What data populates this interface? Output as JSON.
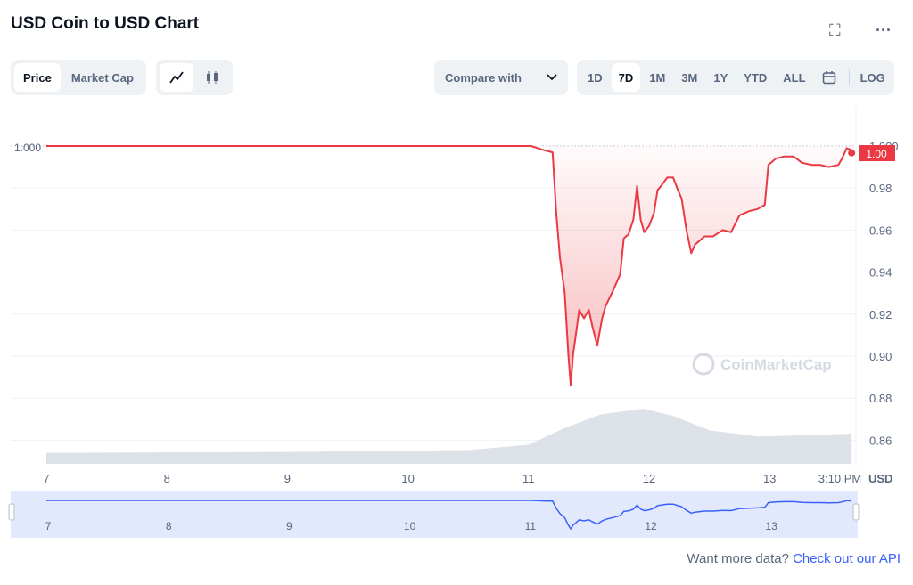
{
  "header": {
    "title": "USD Coin to USD Chart",
    "fullscreen_icon": "expand-icon",
    "more_icon": "more-horizontal-icon"
  },
  "toolbar": {
    "metric_tabs": [
      {
        "label": "Price",
        "active": true
      },
      {
        "label": "Market Cap",
        "active": false
      }
    ],
    "chart_types": [
      {
        "icon": "line-chart-icon",
        "active": true
      },
      {
        "icon": "candlestick-icon",
        "active": false
      }
    ],
    "compare_label": "Compare with",
    "ranges": [
      {
        "label": "1D"
      },
      {
        "label": "7D",
        "active": true
      },
      {
        "label": "1M"
      },
      {
        "label": "3M"
      },
      {
        "label": "1Y"
      },
      {
        "label": "YTD"
      },
      {
        "label": "ALL"
      }
    ],
    "log_label": "LOG"
  },
  "chart_data": {
    "type": "line",
    "ylim": [
      0.85,
      1.0
    ],
    "yticks": [
      "1.000",
      "0.98",
      "0.96",
      "0.94",
      "0.92",
      "0.90",
      "0.88",
      "0.86"
    ],
    "xticks": [
      "7",
      "8",
      "9",
      "10",
      "11",
      "12",
      "13",
      "3:10 PM"
    ],
    "xtick_values": [
      7,
      8,
      9,
      10,
      11,
      12,
      13
    ],
    "unit": "USD",
    "reference_label": "1.000",
    "current_price": "1.00",
    "watermark": "CoinMarketCap",
    "colors": {
      "line": "#ea3943",
      "line_flat": "#16c784",
      "navigator": "#3861fb",
      "volume": "#dde1e8"
    },
    "points": [
      [
        7.0,
        1.0
      ],
      [
        11.02,
        1.0
      ],
      [
        11.13,
        0.998
      ],
      [
        11.2,
        0.997
      ],
      [
        11.23,
        0.968
      ],
      [
        11.26,
        0.947
      ],
      [
        11.3,
        0.93
      ],
      [
        11.33,
        0.901
      ],
      [
        11.35,
        0.886
      ],
      [
        11.37,
        0.901
      ],
      [
        11.39,
        0.909
      ],
      [
        11.42,
        0.922
      ],
      [
        11.46,
        0.918
      ],
      [
        11.5,
        0.922
      ],
      [
        11.53,
        0.914
      ],
      [
        11.57,
        0.905
      ],
      [
        11.61,
        0.918
      ],
      [
        11.64,
        0.924
      ],
      [
        11.7,
        0.931
      ],
      [
        11.76,
        0.939
      ],
      [
        11.79,
        0.956
      ],
      [
        11.83,
        0.958
      ],
      [
        11.87,
        0.965
      ],
      [
        11.9,
        0.981
      ],
      [
        11.93,
        0.965
      ],
      [
        11.96,
        0.959
      ],
      [
        12.0,
        0.962
      ],
      [
        12.04,
        0.968
      ],
      [
        12.07,
        0.979
      ],
      [
        12.1,
        0.981
      ],
      [
        12.15,
        0.985
      ],
      [
        12.2,
        0.985
      ],
      [
        12.24,
        0.979
      ],
      [
        12.27,
        0.975
      ],
      [
        12.31,
        0.96
      ],
      [
        12.35,
        0.949
      ],
      [
        12.38,
        0.953
      ],
      [
        12.46,
        0.957
      ],
      [
        12.53,
        0.957
      ],
      [
        12.61,
        0.96
      ],
      [
        12.68,
        0.959
      ],
      [
        12.75,
        0.967
      ],
      [
        12.83,
        0.969
      ],
      [
        12.9,
        0.97
      ],
      [
        12.96,
        0.972
      ],
      [
        12.99,
        0.991
      ],
      [
        13.05,
        0.994
      ],
      [
        13.12,
        0.995
      ],
      [
        13.2,
        0.995
      ],
      [
        13.27,
        0.992
      ],
      [
        13.35,
        0.991
      ],
      [
        13.42,
        0.991
      ],
      [
        13.49,
        0.99
      ],
      [
        13.57,
        0.991
      ],
      [
        13.6,
        0.994
      ],
      [
        13.64,
        0.999
      ],
      [
        13.68,
        0.998
      ]
    ],
    "volume_relative": [
      [
        7.0,
        0.08
      ],
      [
        9.0,
        0.1
      ],
      [
        10.5,
        0.14
      ],
      [
        11.0,
        0.25
      ],
      [
        11.3,
        0.6
      ],
      [
        11.6,
        0.88
      ],
      [
        11.95,
        1.0
      ],
      [
        12.2,
        0.85
      ],
      [
        12.5,
        0.55
      ],
      [
        12.9,
        0.42
      ],
      [
        13.3,
        0.45
      ],
      [
        13.68,
        0.48
      ]
    ]
  },
  "footer": {
    "text": "Want more data?",
    "link": "Check out our API"
  }
}
